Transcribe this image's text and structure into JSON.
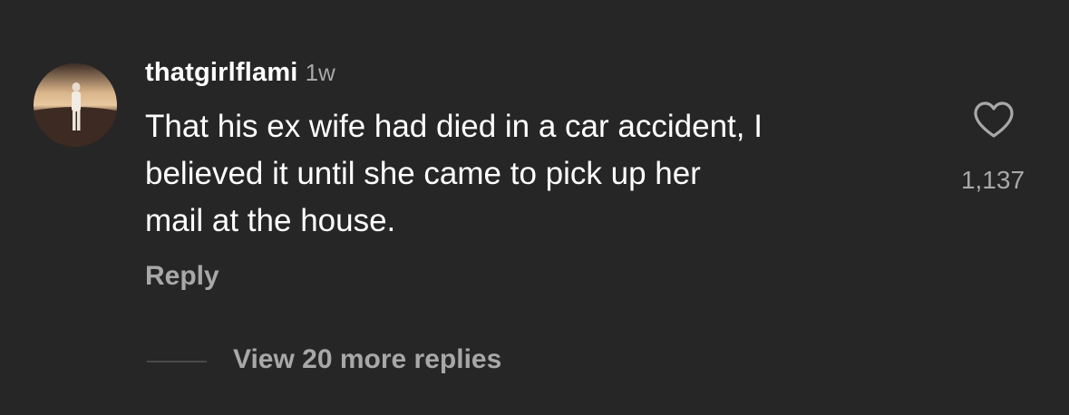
{
  "comment": {
    "username": "thatgirlflami",
    "timestamp": "1w",
    "text_lines": [
      "That his ex wife had died in a car accident, I",
      "believed it until she came to pick up her",
      "mail at the house."
    ],
    "reply_label": "Reply",
    "view_replies_label": "View 20 more replies",
    "like_count": "1,137",
    "like_icon": "heart-icon"
  },
  "colors": {
    "background": "#262626",
    "primary_text": "#ffffff",
    "secondary_text": "#a8a8a8"
  }
}
